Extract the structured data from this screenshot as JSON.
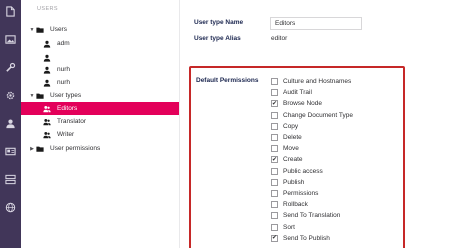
{
  "colors": {
    "rail": "#413659",
    "accent": "#e3005a",
    "highlight_border": "#c62828"
  },
  "rail": {
    "icons": [
      "document-icon",
      "image-icon",
      "wrench-icon",
      "gear-icon",
      "user-icon",
      "id-card-icon",
      "forms-icon",
      "globe-icon"
    ]
  },
  "tree": {
    "section_title": "USERS",
    "nodes": [
      {
        "label": "Users",
        "icon": "folder-icon",
        "expanded": true,
        "depth": 0
      },
      {
        "label": "adm",
        "icon": "user-icon",
        "depth": 1
      },
      {
        "label": "",
        "icon": "user-icon",
        "depth": 1
      },
      {
        "label": "nurh",
        "icon": "user-icon",
        "depth": 1
      },
      {
        "label": "nurh",
        "icon": "user-icon",
        "depth": 1
      },
      {
        "label": "User types",
        "icon": "folder-icon",
        "expanded": true,
        "depth": 0
      },
      {
        "label": "Editors",
        "icon": "user-type-icon",
        "depth": 1,
        "selected": true
      },
      {
        "label": "Translator",
        "icon": "user-type-icon",
        "depth": 1
      },
      {
        "label": "Writer",
        "icon": "user-type-icon",
        "depth": 1
      },
      {
        "label": "User permissions",
        "icon": "folder-icon",
        "expanded": false,
        "depth": 0
      }
    ]
  },
  "editor": {
    "user_type_name_label": "User type Name",
    "user_type_name_value": "Editors",
    "user_type_alias_label": "User type Alias",
    "user_type_alias_value": "editor",
    "default_permissions_label": "Default Permissions",
    "permissions": [
      {
        "label": "Culture and Hostnames",
        "checked": false
      },
      {
        "label": "Audit Trail",
        "checked": false
      },
      {
        "label": "Browse Node",
        "checked": true
      },
      {
        "label": "Change Document Type",
        "checked": false
      },
      {
        "label": "Copy",
        "checked": false
      },
      {
        "label": "Delete",
        "checked": false
      },
      {
        "label": "Move",
        "checked": false
      },
      {
        "label": "Create",
        "checked": true
      },
      {
        "label": "Public access",
        "checked": false
      },
      {
        "label": "Publish",
        "checked": false
      },
      {
        "label": "Permissions",
        "checked": false
      },
      {
        "label": "Rollback",
        "checked": false
      },
      {
        "label": "Send To Translation",
        "checked": false
      },
      {
        "label": "Sort",
        "checked": false
      },
      {
        "label": "Send To Publish",
        "checked": true
      }
    ]
  }
}
